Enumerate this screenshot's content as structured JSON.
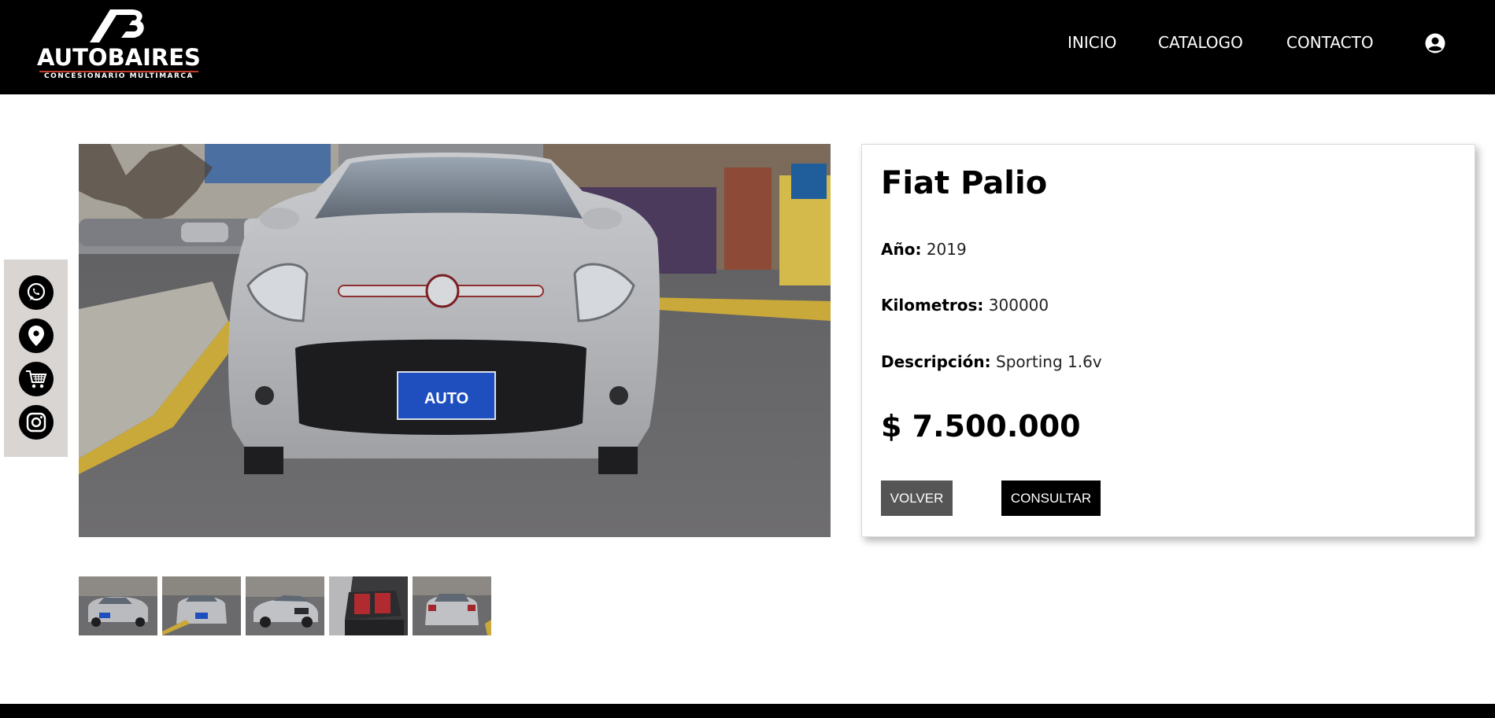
{
  "header": {
    "logo_name": "AUTOBAIRES",
    "logo_sub": "CONCESIONARIO MULTIMARCA",
    "nav": [
      "INICIO",
      "CATALOGO",
      "CONTACTO"
    ]
  },
  "social": {
    "items": [
      "whatsapp-icon",
      "location-icon",
      "cart-icon",
      "instagram-icon"
    ]
  },
  "car": {
    "title": "Fiat Palio",
    "year_label": "Año:",
    "year": "2019",
    "km_label": "Kilometros:",
    "km": "300000",
    "desc_label": "Descripción:",
    "desc": "Sporting 1.6v",
    "price": "$ 7.500.000",
    "plate_text": "AUTO"
  },
  "buttons": {
    "volver": "VOLVER",
    "consultar": "CONSULTAR"
  },
  "thumbnails": [
    "front-left view",
    "front view",
    "side view",
    "interior rear seats",
    "rear view"
  ],
  "colors": {
    "header_bg": "#000000",
    "sidebar_bg": "#d9d5d2",
    "btn_volver": "#555555",
    "btn_consultar": "#000000"
  }
}
